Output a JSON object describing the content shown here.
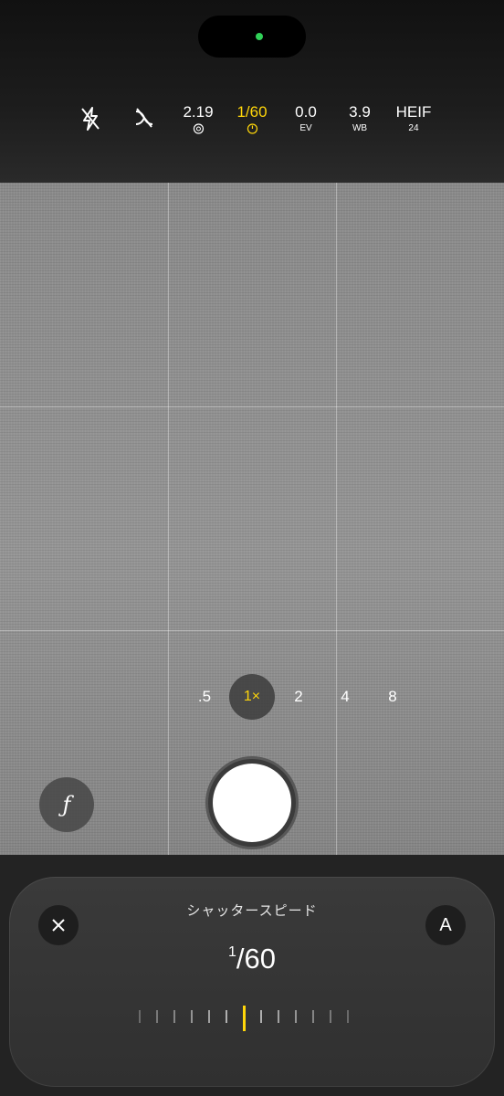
{
  "status": {
    "indicator_color": "#30d158"
  },
  "top_controls": {
    "flash": {
      "icon": "flash-off-icon"
    },
    "live_photo": {
      "icon": "live-off-icon"
    },
    "aperture": {
      "value": "2.19",
      "icon": "aperture-icon"
    },
    "shutter": {
      "value": "1/60",
      "icon": "timer-icon",
      "active": true
    },
    "ev": {
      "value": "0.0",
      "label": "EV"
    },
    "wb": {
      "value": "3.9",
      "label": "WB"
    },
    "format": {
      "value": "HEIF",
      "label": "24"
    }
  },
  "zoom": {
    "options": [
      ".5",
      "1×",
      "2",
      "4",
      "8"
    ],
    "selected": "1×"
  },
  "f_button": {
    "label": "ƒ"
  },
  "panel": {
    "title": "シャッタースピード",
    "close_icon": "close-icon",
    "auto_label": "A",
    "value_numerator": "1",
    "value_denominator": "/60",
    "tick_count": 13,
    "selected_tick": 6
  },
  "colors": {
    "accent": "#ffd60a",
    "panel": "#303030"
  }
}
